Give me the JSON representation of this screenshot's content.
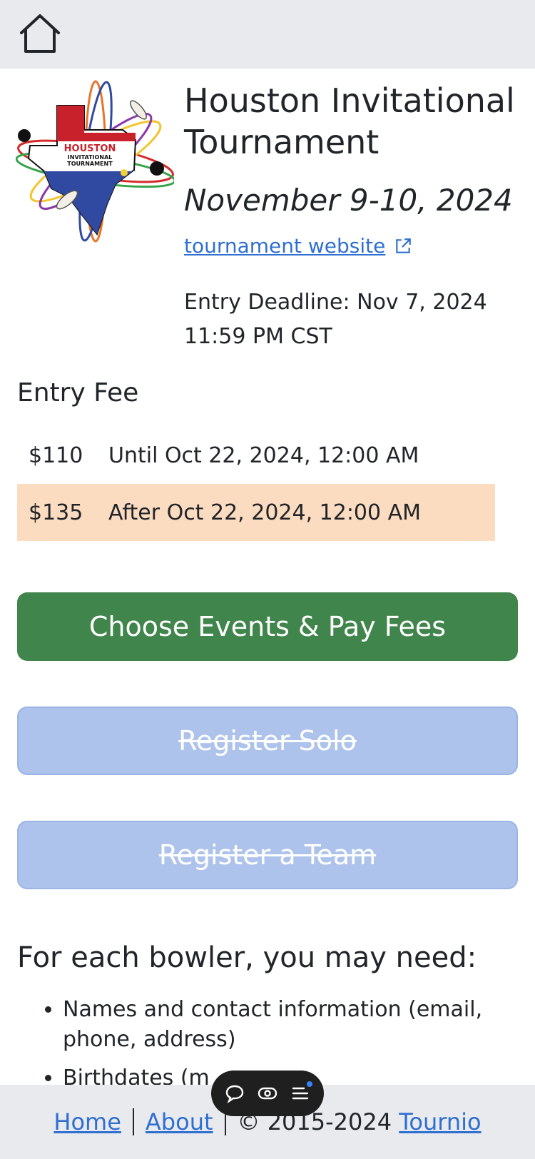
{
  "tournament": {
    "title": "Houston Invitational Tournament",
    "dates": "November 9-10, 2024",
    "website_label": "tournament website",
    "deadline": "Entry Deadline: Nov 7, 2024 11:59 PM CST",
    "logo_text": [
      "HOUSTON",
      "INVITATIONAL",
      "TOURNAMENT"
    ]
  },
  "entry_fee": {
    "heading": "Entry Fee",
    "rows": [
      {
        "amount": "$110",
        "label": "Until Oct 22, 2024, 12:00 AM"
      },
      {
        "amount": "$135",
        "label": "After Oct 22, 2024, 12:00 AM"
      }
    ]
  },
  "buttons": {
    "choose_events": "Choose Events & Pay Fees",
    "register_solo": "Register Solo",
    "register_team": "Register a Team"
  },
  "requirements": {
    "heading": "For each bowler, you may need:",
    "items": [
      "Names and contact information (email, phone, address)",
      "Birthdates (m"
    ]
  },
  "footer": {
    "home": "Home",
    "about": "About",
    "copyright": "© 2015-2024",
    "brand": "Tournio"
  },
  "colors": {
    "primary_button": "#40854b",
    "disabled_button": "#aec3ec",
    "highlight_row": "#fcdcc1",
    "link": "#2f6fd0"
  }
}
